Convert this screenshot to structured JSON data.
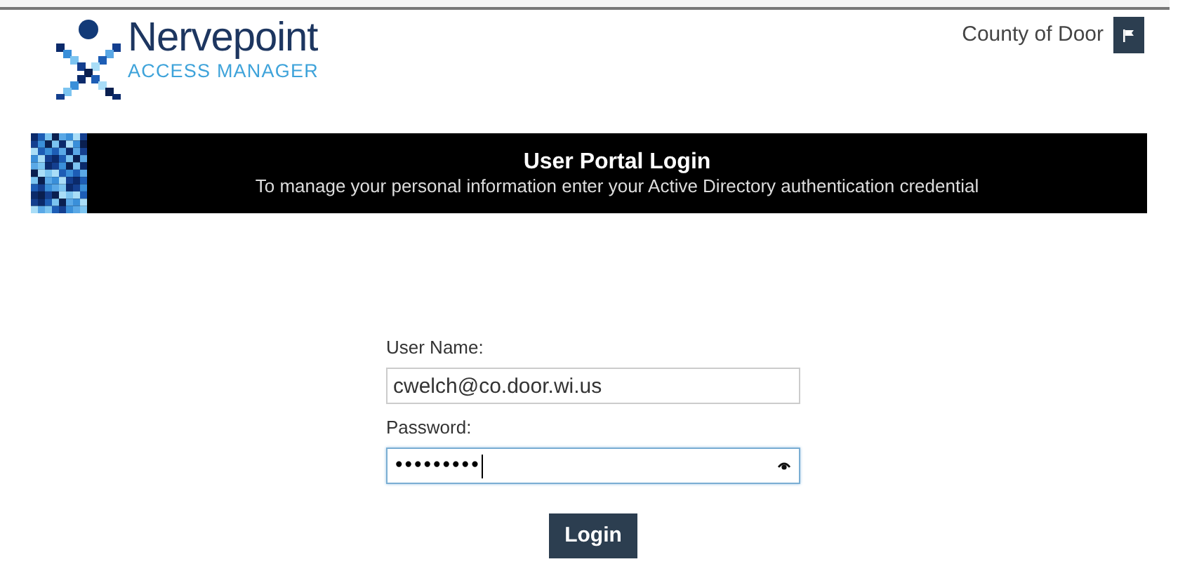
{
  "header": {
    "brand": "Nervepoint",
    "tagline": "ACCESS MANAGER",
    "organization": "County of Door"
  },
  "banner": {
    "title": "User Portal Login",
    "subtitle": "To manage your personal information enter your Active Directory authentication credential"
  },
  "form": {
    "fields": [
      {
        "label": "User Name:",
        "value": "cwelch@co.door.wi.us",
        "kind": "text",
        "focused": false
      },
      {
        "label": "Password:",
        "value": "•••••••••",
        "kind": "password",
        "focused": true
      }
    ],
    "submit": "Login"
  }
}
